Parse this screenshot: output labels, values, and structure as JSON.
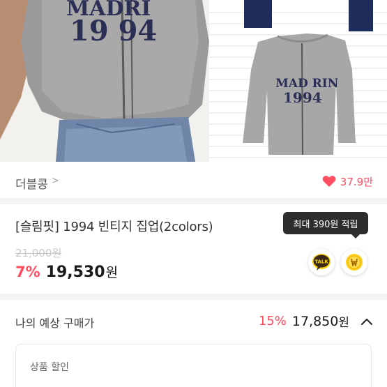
{
  "hero": {
    "model_jacket_text_top": "MADRI",
    "model_jacket_year": "19 94",
    "product_jacket_text_top": "MAD RIN",
    "product_jacket_year": "1994",
    "icon": "expand-icon"
  },
  "brand": {
    "name": "더블콩",
    "chevron": ">",
    "like_count": "37.9만",
    "like_icon": "heart-icon",
    "like_color": "#ff4c5e"
  },
  "product": {
    "title": "[슬림핏] 1994 빈티지 집업(2colors)",
    "original_price": "21,000원",
    "discount_rate": "7%",
    "sale_price": "19,530",
    "currency": "원"
  },
  "tooltip": {
    "text": "최대 390원 적립"
  },
  "actions": {
    "talk_label": "TALK",
    "talk_icon": "kakao-talk-icon",
    "coin_icon": "coin-icon"
  },
  "expected": {
    "label": "나의 예상 구매가",
    "rate": "15%",
    "price": "17,850",
    "currency": "원",
    "icon": "chevron-up-icon"
  },
  "discount_card": {
    "title": "상품 할인"
  },
  "colors": {
    "accent": "#ff4c5e",
    "text": "#222222",
    "muted": "#999999"
  }
}
